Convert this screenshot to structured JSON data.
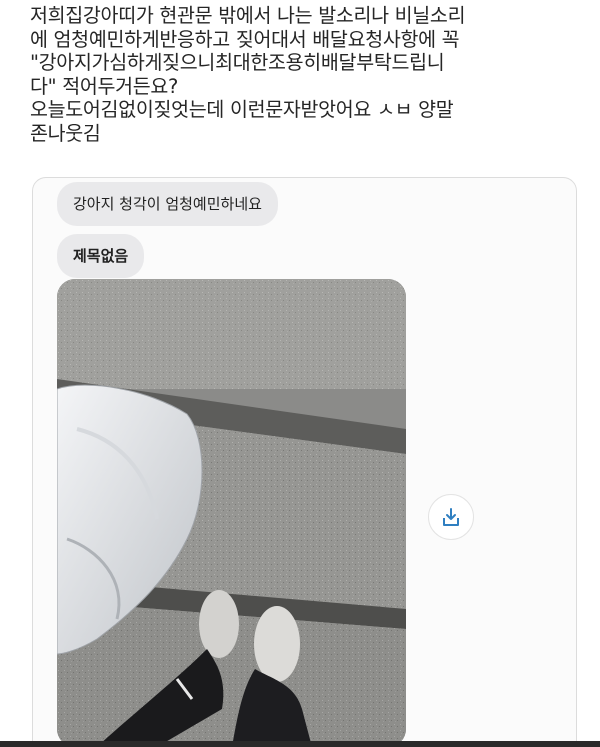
{
  "post": {
    "lines": [
      "저희집강아띠가 현관문 밖에서 나는 발소리나 비닐소리",
      "에 엄청예민하게반응하고 짖어대서 배달요청사항에 꼭",
      "\"강아지가심하게짖으니최대한조용히배달부탁드립니",
      "다\" 적어두거든요?",
      "오늘도어김없이짖엇는데 이런문자받앗어요 ㅅㅂ 양말",
      "존나웃김"
    ]
  },
  "message": {
    "bubble_1": "강아지 청각이 엄청예민하네요",
    "bubble_2": "제목없음",
    "save_icon": "download-icon"
  },
  "colors": {
    "text": "#262626",
    "bubble_bg": "#e9e9eb",
    "icon_accent": "#2f7fc1"
  }
}
